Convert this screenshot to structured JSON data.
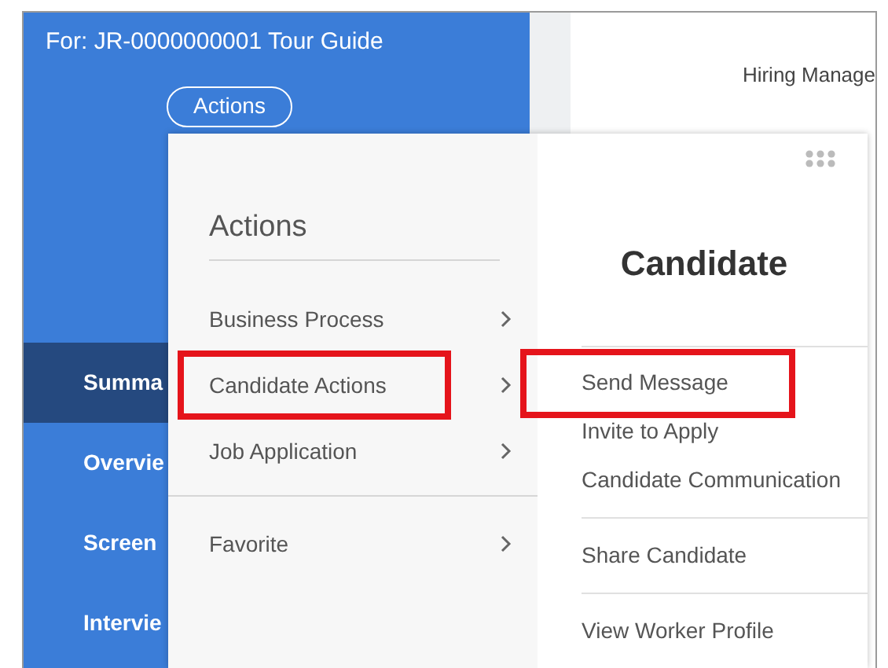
{
  "header": {
    "title": "For: JR-0000000001 Tour Guide",
    "actions_button": "Actions"
  },
  "right_panel": {
    "column_label": "Hiring Manage"
  },
  "sidebar": {
    "items": [
      {
        "label": "Summa",
        "selected": true
      },
      {
        "label": "Overvie",
        "selected": false
      },
      {
        "label": "Screen",
        "selected": false
      },
      {
        "label": "Intervie",
        "selected": false
      }
    ]
  },
  "actions_menu": {
    "title": "Actions",
    "groups": [
      [
        {
          "label": "Business Process",
          "has_submenu": true,
          "highlighted": false
        },
        {
          "label": "Candidate Actions",
          "has_submenu": true,
          "highlighted": true
        },
        {
          "label": "Job Application",
          "has_submenu": true,
          "highlighted": false
        }
      ],
      [
        {
          "label": "Favorite",
          "has_submenu": true,
          "highlighted": false
        }
      ]
    ]
  },
  "submenu": {
    "title": "Candidate",
    "groups": [
      [
        {
          "label": "Send Message",
          "highlighted": true
        },
        {
          "label": "Invite to Apply",
          "highlighted": false
        },
        {
          "label": "Candidate Communication",
          "highlighted": false
        }
      ],
      [
        {
          "label": "Share Candidate",
          "highlighted": false
        }
      ],
      [
        {
          "label": "View Worker Profile",
          "highlighted": false
        }
      ]
    ]
  }
}
